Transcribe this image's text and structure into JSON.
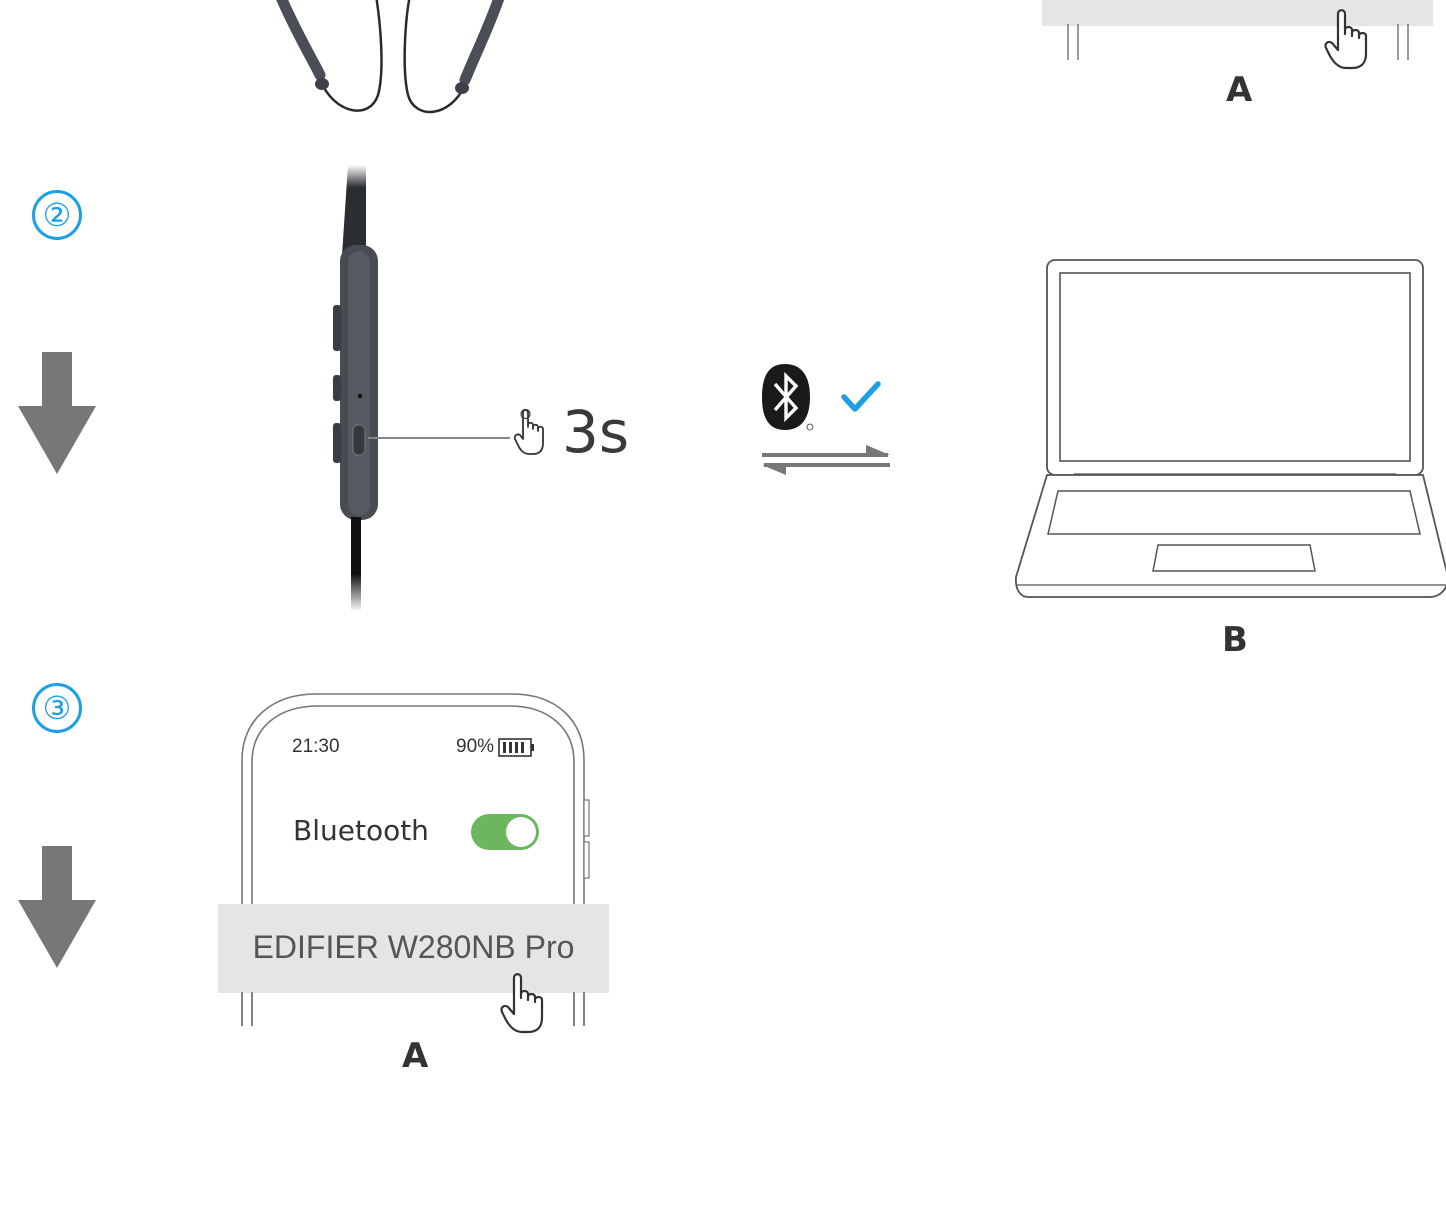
{
  "steps": [
    {
      "number": "②"
    },
    {
      "number": "③"
    }
  ],
  "labels": {
    "phone_top": "A",
    "laptop": "B",
    "phone_bottom": "A"
  },
  "press": {
    "duration": "3s"
  },
  "phone": {
    "time": "21:30",
    "battery": "90%",
    "bluetooth_label": "Bluetooth",
    "bluetooth_enabled": true,
    "device_name": "EDIFIER W280NB Pro"
  },
  "icons": {
    "arrow": "arrow-down-icon",
    "bluetooth": "bluetooth-icon",
    "check": "checkmark-icon",
    "exchange": "exchange-arrows-icon",
    "hand": "hand-pointer-icon"
  },
  "colors": {
    "accent_blue": "#1e9ee6",
    "arrow_gray": "#777777",
    "toggle_green": "#6cb65e",
    "highlight_gray": "#e5e5e5"
  }
}
